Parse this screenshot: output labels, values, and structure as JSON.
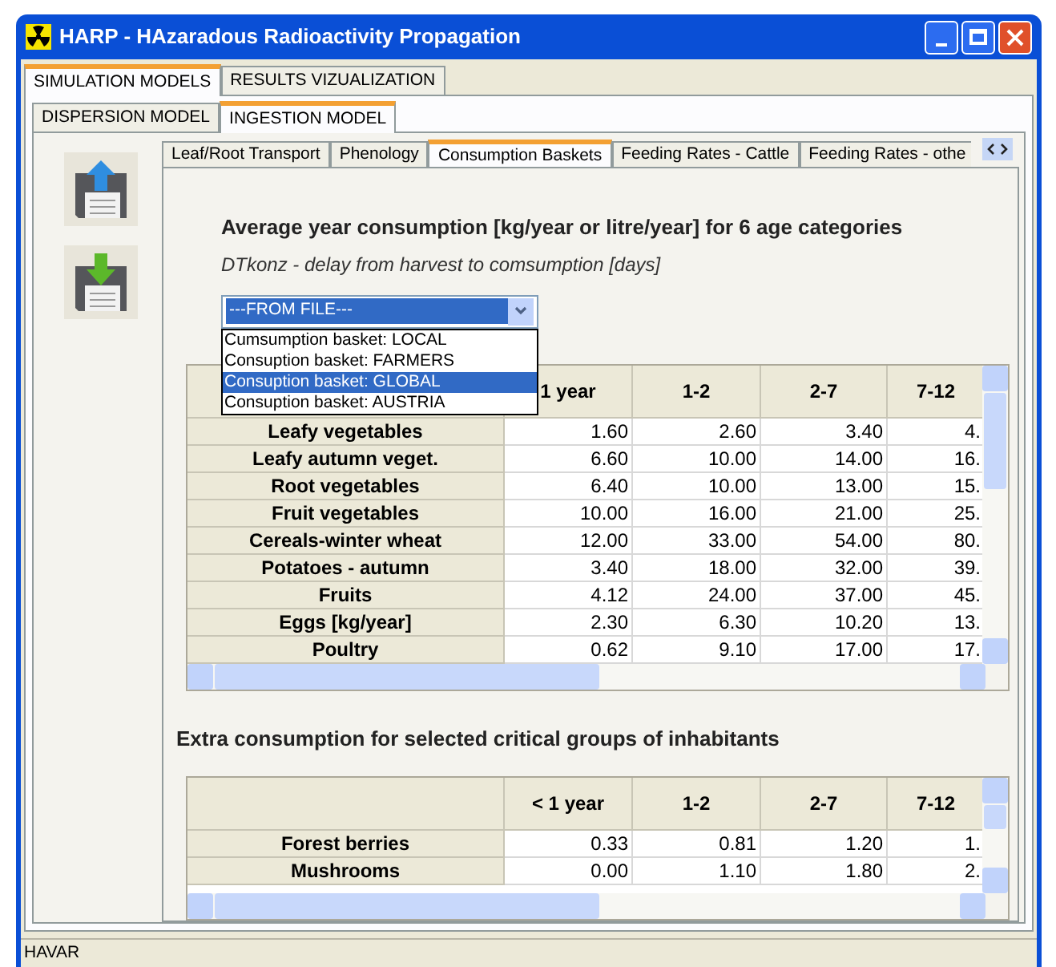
{
  "window": {
    "title": "HARP - HAzaradous Radioactivity Propagation"
  },
  "main_tabs": [
    {
      "label": "SIMULATION MODELS",
      "selected": true
    },
    {
      "label": "RESULTS VIZUALIZATION",
      "selected": false
    }
  ],
  "model_tabs": [
    {
      "label": "DISPERSION MODEL",
      "selected": false
    },
    {
      "label": "INGESTION MODEL",
      "selected": true
    }
  ],
  "sub_tabs": [
    {
      "label": "Leaf/Root Transport",
      "selected": false
    },
    {
      "label": "Phenology",
      "selected": false
    },
    {
      "label": "Consumption Baskets",
      "selected": true
    },
    {
      "label": "Feeding Rates - Cattle",
      "selected": false
    },
    {
      "label": "Feeding Rates - othe",
      "selected": false
    }
  ],
  "heading": "Average year consumption [kg/year or litre/year] for 6 age categories",
  "subheading": "DTkonz - delay from harvest to comsumption [days]",
  "basket_select": {
    "value": "---FROM FILE---",
    "options": [
      {
        "label": "Cumsumption basket: LOCAL",
        "selected": false
      },
      {
        "label": "Consuption basket: FARMERS",
        "selected": false
      },
      {
        "label": "Consuption basket: GLOBAL",
        "selected": true
      },
      {
        "label": "Consuption basket: AUSTRIA",
        "selected": false
      }
    ]
  },
  "table": {
    "columns": [
      "1 year",
      "1-2",
      "2-7",
      "7-12"
    ],
    "rows": [
      {
        "label": "Leafy vegetables",
        "values": [
          "1.60",
          "2.60",
          "3.40",
          "4."
        ]
      },
      {
        "label": "Leafy autumn veget.",
        "values": [
          "6.60",
          "10.00",
          "14.00",
          "16."
        ]
      },
      {
        "label": "Root vegetables",
        "values": [
          "6.40",
          "10.00",
          "13.00",
          "15."
        ]
      },
      {
        "label": "Fruit vegetables",
        "values": [
          "10.00",
          "16.00",
          "21.00",
          "25."
        ]
      },
      {
        "label": "Cereals-winter wheat",
        "values": [
          "12.00",
          "33.00",
          "54.00",
          "80."
        ]
      },
      {
        "label": "Potatoes - autumn",
        "values": [
          "3.40",
          "18.00",
          "32.00",
          "39."
        ]
      },
      {
        "label": "Fruits",
        "values": [
          "4.12",
          "24.00",
          "37.00",
          "45."
        ]
      },
      {
        "label": "Eggs [kg/year]",
        "values": [
          "2.30",
          "6.30",
          "10.20",
          "13."
        ]
      },
      {
        "label": "Poultry",
        "values": [
          "0.62",
          "9.10",
          "17.00",
          "17."
        ]
      }
    ]
  },
  "extra_heading": "Extra consumption for selected critical groups of inhabitants",
  "extra_table": {
    "columns": [
      "< 1 year",
      "1-2",
      "2-7",
      "7-12"
    ],
    "rows": [
      {
        "label": "Forest berries",
        "values": [
          "0.33",
          "0.81",
          "1.20",
          "1."
        ]
      },
      {
        "label": "Mushrooms",
        "values": [
          "0.00",
          "1.10",
          "1.80",
          "2."
        ]
      }
    ]
  },
  "status_bar": "HAVAR"
}
